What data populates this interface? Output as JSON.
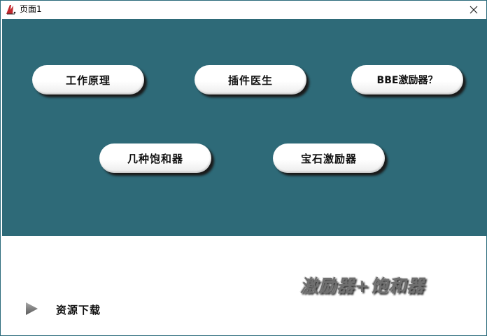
{
  "window": {
    "title": "页面1",
    "app_icon": "app-logo-icon",
    "close_icon": "close-icon"
  },
  "buttons": {
    "working_principle": "工作原理",
    "plugin_doctor": "插件医生",
    "bbe_exciter": "BBE激励器？",
    "saturators": "几种饱和器",
    "gem_exciter": "宝石激励器"
  },
  "bottom": {
    "download_label": "资源下载",
    "play_icon": "play-arrow-icon",
    "slogan": "激励器+饱和器"
  },
  "colors": {
    "panel_bg": "#2e6a78",
    "button_bg": "#ffffff",
    "slogan_color": "#6f6f6f"
  }
}
